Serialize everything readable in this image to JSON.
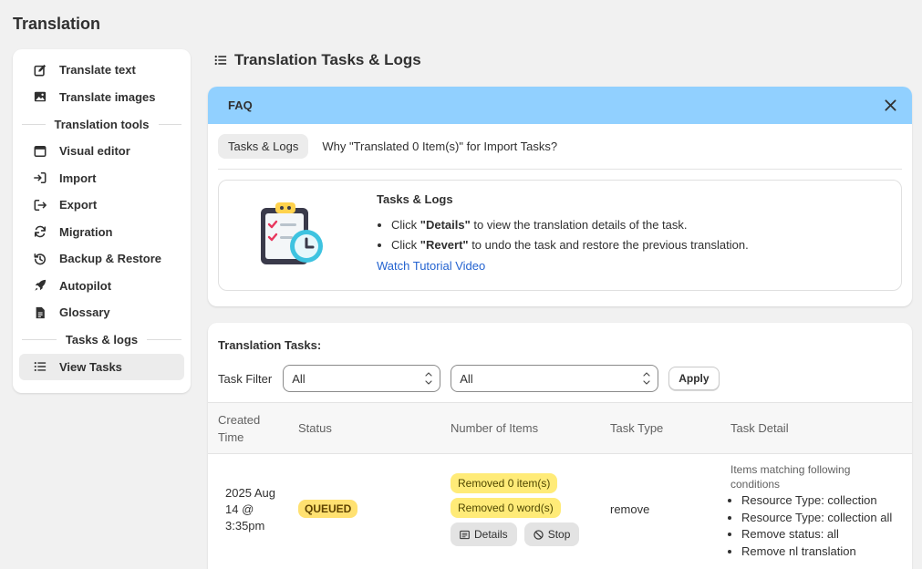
{
  "app": {
    "title": "Translation"
  },
  "sidebar": {
    "items_top": [
      {
        "label": "Translate text",
        "icon": "edit-icon"
      },
      {
        "label": "Translate images",
        "icon": "image-icon"
      }
    ],
    "section_tools": "Translation tools",
    "items_tools": [
      {
        "label": "Visual editor",
        "icon": "browser-window-icon"
      },
      {
        "label": "Import",
        "icon": "import-icon"
      },
      {
        "label": "Export",
        "icon": "export-icon"
      },
      {
        "label": "Migration",
        "icon": "refresh-icon"
      },
      {
        "label": "Backup & Restore",
        "icon": "history-icon"
      },
      {
        "label": "Autopilot",
        "icon": "rocket-icon"
      },
      {
        "label": "Glossary",
        "icon": "document-icon"
      }
    ],
    "section_tasks": "Tasks & logs",
    "items_tasks": [
      {
        "label": "View Tasks",
        "icon": "list-icon",
        "active": true
      }
    ]
  },
  "main": {
    "title": "Translation Tasks & Logs"
  },
  "faq": {
    "title": "FAQ",
    "tabs": [
      "Tasks & Logs",
      "Why \"Translated 0 Item(s)\" for Import Tasks?"
    ],
    "active_tab": 0,
    "content": {
      "heading": "Tasks & Logs",
      "bullet1_pre": "Click ",
      "bullet1_bold": "\"Details\"",
      "bullet1_post": " to view the translation details of the task.",
      "bullet2_pre": "Click ",
      "bullet2_bold": "\"Revert\"",
      "bullet2_post": " to undo the task and restore the previous translation.",
      "link": "Watch Tutorial Video"
    }
  },
  "tasks": {
    "title": "Translation Tasks:",
    "filter_label": "Task Filter",
    "filter1_value": "All",
    "filter2_value": "All",
    "apply_label": "Apply",
    "headers": {
      "created_line1": "Created",
      "created_line2": "Time",
      "status": "Status",
      "items": "Number of Items",
      "type": "Task Type",
      "detail": "Task Detail"
    },
    "rows": [
      {
        "created_line1": "2025 Aug",
        "created_line2": "14 @",
        "created_line3": "3:35pm",
        "status": "QUEUED",
        "removed_items": "Removed 0 item(s)",
        "removed_words": "Removed 0 word(s)",
        "details_label": "Details",
        "stop_label": "Stop",
        "type": "remove",
        "detail_intro": "Items matching following conditions",
        "detail_list": [
          "Resource Type: collection",
          "Resource Type: collection all",
          "Remove status: all",
          "Remove nl translation"
        ]
      }
    ]
  },
  "colors": {
    "faq_header": "#91d0ff",
    "queued_badge": "#ffe171",
    "count_badge": "#ffeb78",
    "link": "#2463d0"
  }
}
